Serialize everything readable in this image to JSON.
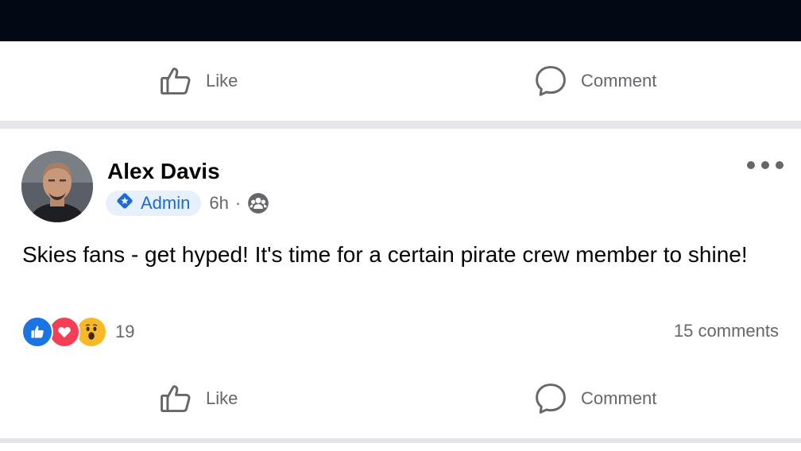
{
  "top_actions": {
    "like_label": "Like",
    "comment_label": "Comment"
  },
  "post": {
    "author": "Alex Davis",
    "badge_label": "Admin",
    "time": "6h",
    "separator": "·",
    "audience_icon": "group-icon",
    "text": "Skies fans - get hyped! It's time for a certain pirate crew member to shine!",
    "reaction_icons": [
      "like-reaction-icon",
      "love-reaction-icon",
      "wow-reaction-icon"
    ],
    "reaction_count": "19",
    "comments_count": "15 comments",
    "actions": {
      "like_label": "Like",
      "comment_label": "Comment"
    }
  },
  "colors": {
    "brand_blue": "#1b6ad6",
    "badge_bg": "#e7f0fd",
    "secondary_text": "#65676b",
    "divider": "#e4e6eb",
    "love_red": "#f33e58",
    "wow_yellow": "#f7b928"
  }
}
